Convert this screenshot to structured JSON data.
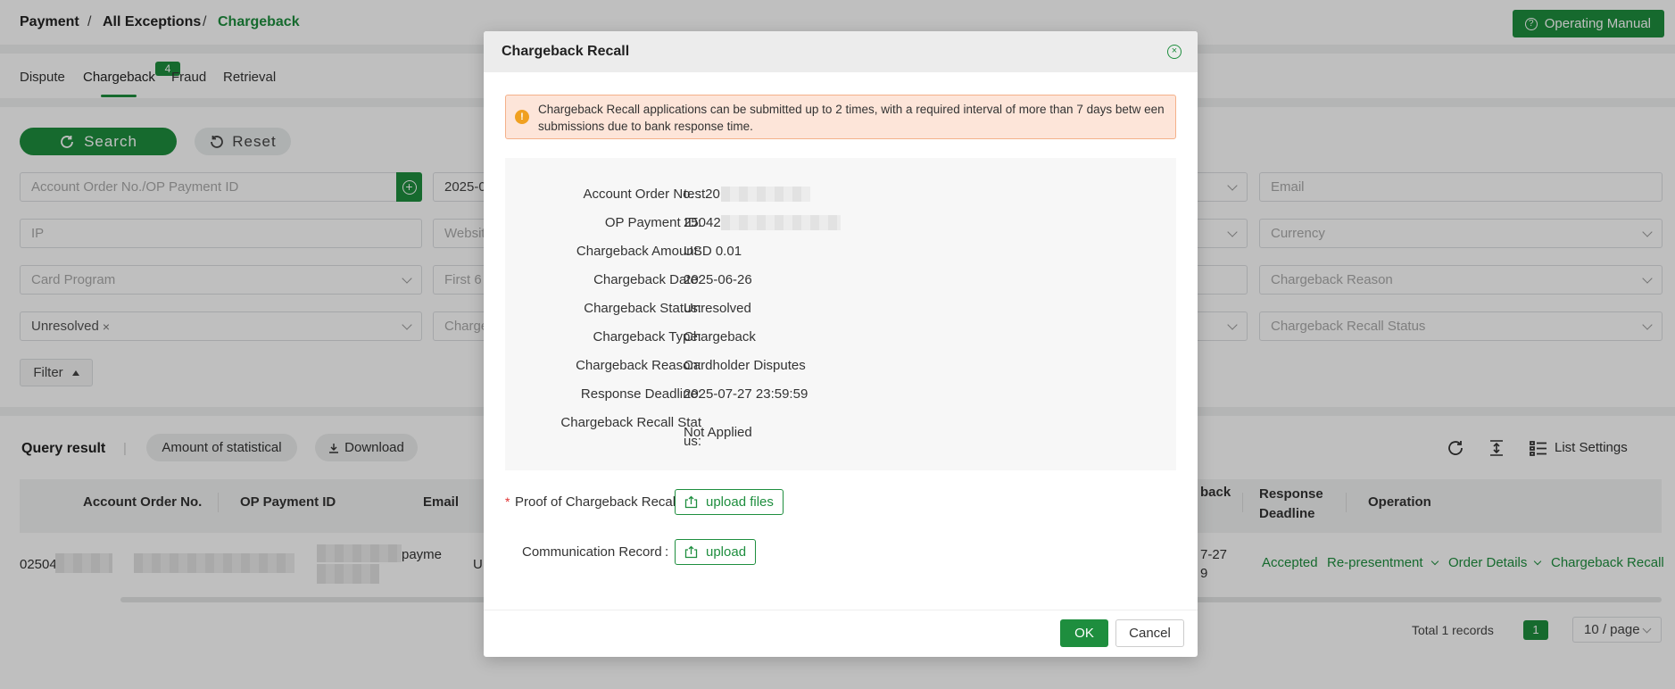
{
  "breadcrumb": {
    "items": [
      "Payment",
      "All Exceptions",
      "Chargeback"
    ],
    "separator": "/"
  },
  "header": {
    "manual_button": "Operating Manual",
    "manual_icon": "question-circle-icon"
  },
  "tabs": {
    "items": [
      "Dispute",
      "Chargeback",
      "Fraud",
      "Retrieval"
    ],
    "active": "Chargeback",
    "chargeback_badge": "4"
  },
  "filters": {
    "search_label": "Search",
    "reset_label": "Reset",
    "order_placeholder": "Account Order No./OP Payment ID",
    "date_value": "2025-0",
    "email_placeholder": "Email",
    "ip_placeholder": "IP",
    "website_placeholder": "Websit",
    "currency_placeholder": "Currency",
    "card_program_placeholder": "Card Program",
    "first6_placeholder": "First 6",
    "reason_placeholder": "Chargeback Reason",
    "status_tag": "Unresolved",
    "status_tag_close": "×",
    "charge_placeholder": "Charge",
    "recall_status_placeholder": "Chargeback Recall Status",
    "filter_button": "Filter"
  },
  "results": {
    "title": "Query result",
    "separator": "|",
    "amount_btn": "Amount of statistical",
    "download_btn": "Download",
    "list_settings": "List Settings",
    "columns": [
      "Account Order No.",
      "OP Payment ID",
      "Email",
      "back",
      "Response Deadline",
      "Operation"
    ],
    "row": {
      "order_prefix": "02504",
      "email_fragment": "payme",
      "currency_fragment": "U",
      "deadline_fragment_1": "7-27",
      "deadline_fragment_2": "9",
      "ops": [
        "Accepted",
        "Re-presentment",
        "Order Details",
        "Chargeback Recall"
      ]
    },
    "total": "Total 1 records",
    "page": "1",
    "page_size": "10 / page"
  },
  "modal": {
    "title": "Chargeback Recall",
    "warning": "Chargeback Recall applications can be submitted up to 2 times, with a required interval of more than 7 days betw een submissions due to bank response time.",
    "fields": [
      {
        "label": "Account Order No. :",
        "value": "test20"
      },
      {
        "label": "OP Payment ID:",
        "value": "25042"
      },
      {
        "label": "Chargeback Amount:",
        "value": "USD 0.01"
      },
      {
        "label": "Chargeback Date:",
        "value": "2025-06-26"
      },
      {
        "label": "Chargeback Status:",
        "value": "Unresolved"
      },
      {
        "label": "Chargeback Type:",
        "value": "Chargeback"
      },
      {
        "label": "Chargeback Reason:",
        "value": "Cardholder Disputes"
      },
      {
        "label": "Response Deadline:",
        "value": "2025-07-27 23:59:59"
      }
    ],
    "recall_status_label_1": "Chargeback Recall Stat",
    "recall_status_label_2": "us:",
    "recall_status_value": "Not Applied",
    "proof_star": "*",
    "proof_label": "Proof of Chargeback Recall",
    "upload_files": "upload files",
    "comm_label": "Communication Record",
    "upload": "upload",
    "ok": "OK",
    "cancel": "Cancel"
  },
  "colors": {
    "brand": "#1e8e3e",
    "warning_bg": "#fde5d9",
    "warning_border": "#f4b18a"
  }
}
